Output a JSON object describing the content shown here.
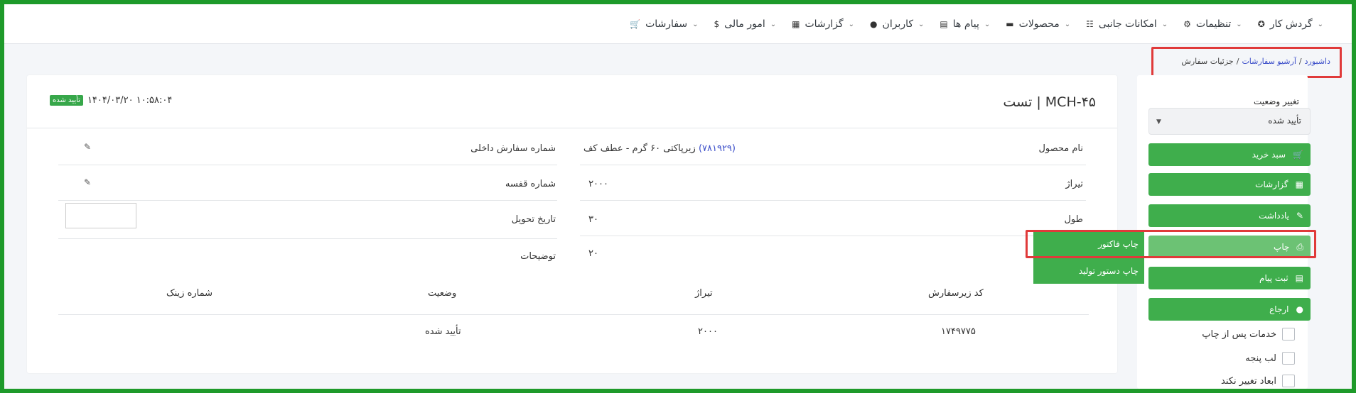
{
  "nav": [
    {
      "label": "سفارشات",
      "icon": "cart-icon"
    },
    {
      "label": "امور مالی",
      "icon": "dollar-icon"
    },
    {
      "label": "گزارشات",
      "icon": "report-icon"
    },
    {
      "label": "کاربران",
      "icon": "user-icon"
    },
    {
      "label": "پیام ها",
      "icon": "message-icon"
    },
    {
      "label": "محصولات",
      "icon": "store-icon"
    },
    {
      "label": "امکانات جانبی",
      "icon": "grid-icon"
    },
    {
      "label": "تنظیمات",
      "icon": "gear-icon"
    },
    {
      "label": "گردش کار",
      "icon": "workflow-icon"
    }
  ],
  "breadcrumb": {
    "home": "داشبورد",
    "sep": "/",
    "archive": "آرشیو سفارشات",
    "current": "جزئیات سفارش"
  },
  "sidebar": {
    "status_label": "تغییر وضعیت",
    "status_value": "تأیید شده",
    "buttons": [
      {
        "label": "سبد خرید",
        "icon": "cart-icon"
      },
      {
        "label": "گزارشات",
        "icon": "report-icon"
      },
      {
        "label": "یادداشت",
        "icon": "pencil-icon"
      },
      {
        "label": "چاپ",
        "icon": "print-icon"
      },
      {
        "label": "ثبت پیام",
        "icon": "message-icon"
      },
      {
        "label": "ارجاع",
        "icon": "user-icon"
      }
    ],
    "checkboxes": [
      "خدمات پس از چاپ",
      "لب پنجه",
      "ابعاد تغییر نکند"
    ]
  },
  "print_menu": [
    "چاپ فاکتور",
    "چاپ دستور تولید"
  ],
  "order": {
    "title": "MCH-۴۵ | تست",
    "date": "۱۴۰۴/۰۳/۲۰ ۱۰:۵۸:۰۴",
    "status_badge": "تأیید شده",
    "fields": {
      "product_label": "نام محصول",
      "product_code": "(۷۸۱۹۲۹)",
      "product_name": "زیرپاکتی ۶۰ گرم - عطف کف",
      "circulation_label": "تیراژ",
      "circulation_value": "۲۰۰۰",
      "length_label": "طول",
      "length_value": "۳۰",
      "width_value": "۲۰",
      "internal_label": "شماره سفارش داخلی",
      "shelf_label": "شماره قفسه",
      "delivery_label": "تاریخ تحویل",
      "desc_label": "توضیحات"
    },
    "table": {
      "headers": [
        "کد زیرسفارش",
        "تیراژ",
        "وضعیت",
        "شماره زینک"
      ],
      "row": [
        "۱۷۴۹۷۷۵",
        "۲۰۰۰",
        "تأیید شده",
        ""
      ]
    }
  }
}
